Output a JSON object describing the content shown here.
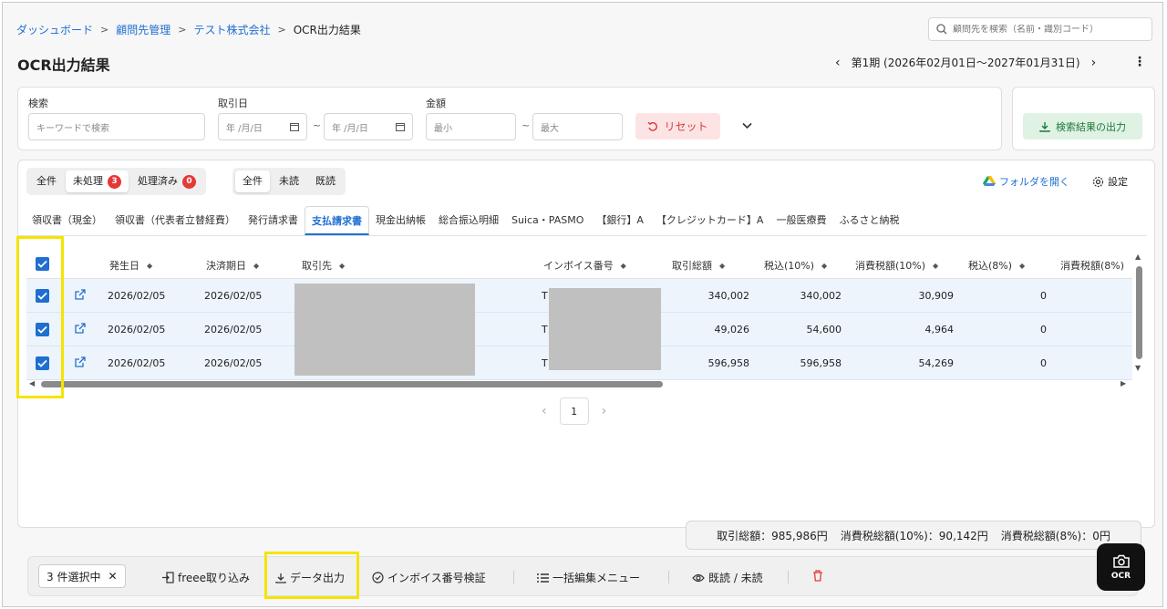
{
  "breadcrumb": {
    "items": [
      "ダッシュボード",
      "顧問先管理",
      "テスト株式会社"
    ],
    "current": "OCR出力結果",
    "separator": ">"
  },
  "search": {
    "placeholder": "顧問先を検索（名前・識別コード）"
  },
  "page_title": "OCR出力結果",
  "period": {
    "label": "第1期 (2026年02月01日〜2027年01月31日)",
    "prev": "‹",
    "next": "›"
  },
  "filters": {
    "keyword_label": "検索",
    "keyword_placeholder": "キーワードで検索",
    "date_label": "取引日",
    "date_placeholder": "年 /月/日",
    "tilde": "~",
    "amount_label": "金額",
    "min_placeholder": "最小",
    "max_placeholder": "最大",
    "reset_label": "リセット",
    "export_label": "検索結果の出力"
  },
  "status_filter": {
    "options": [
      "全件",
      "未処理",
      "処理済み"
    ],
    "badges": {
      "unprocessed": "3",
      "processed": "0"
    }
  },
  "read_filter": {
    "options": [
      "全件",
      "未読",
      "既読"
    ]
  },
  "folder_link": "フォルダを開く",
  "settings_label": "設定",
  "doc_tabs": [
    "領収書（現金）",
    "領収書（代表者立替経費）",
    "発行請求書",
    "支払請求書",
    "現金出納帳",
    "総合振込明細",
    "Suica・PASMO",
    "【銀行】A",
    "【クレジットカード】A",
    "一般医療費",
    "ふるさと納税"
  ],
  "active_tab": "支払請求書",
  "table": {
    "columns": [
      "発生日",
      "決済期日",
      "取引先",
      "インボイス番号",
      "取引総額",
      "税込(10%)",
      "消費税額(10%)",
      "税込(8%)",
      "消費税額(8%)"
    ],
    "rows": [
      {
        "date": "2026/02/05",
        "due": "2026/02/05",
        "partner": "",
        "invoice_prefix": "T",
        "total": "340,002",
        "tax_incl_10": "340,002",
        "tax_10": "30,909",
        "tax_incl_8": "0"
      },
      {
        "date": "2026/02/05",
        "due": "2026/02/05",
        "partner": "",
        "invoice_prefix": "T",
        "total": "49,026",
        "tax_incl_10": "54,600",
        "tax_10": "4,964",
        "tax_incl_8": "0"
      },
      {
        "date": "2026/02/05",
        "due": "2026/02/05",
        "partner": "",
        "invoice_prefix": "T",
        "total": "596,958",
        "tax_incl_10": "596,958",
        "tax_10": "54,269",
        "tax_incl_8": "0"
      }
    ]
  },
  "pagination": {
    "current": "1"
  },
  "totals": {
    "total": "取引総額：985,986円",
    "tax10": "消費税総額(10%)：90,142円",
    "tax8": "消費税総額(8%)：0円"
  },
  "bulk_bar": {
    "selected": "3 件選択中",
    "freee": "freee取り込み",
    "data_export": "データ出力",
    "invoice_check": "インボイス番号検証",
    "bulk_edit": "一括編集メニュー",
    "read_toggle": "既読 / 未読"
  },
  "ocr_button": "OCR",
  "colors": {
    "accent": "#1f6fd1",
    "highlight": "#f5e400",
    "danger": "#e53935",
    "success": "#1e7a3c"
  }
}
